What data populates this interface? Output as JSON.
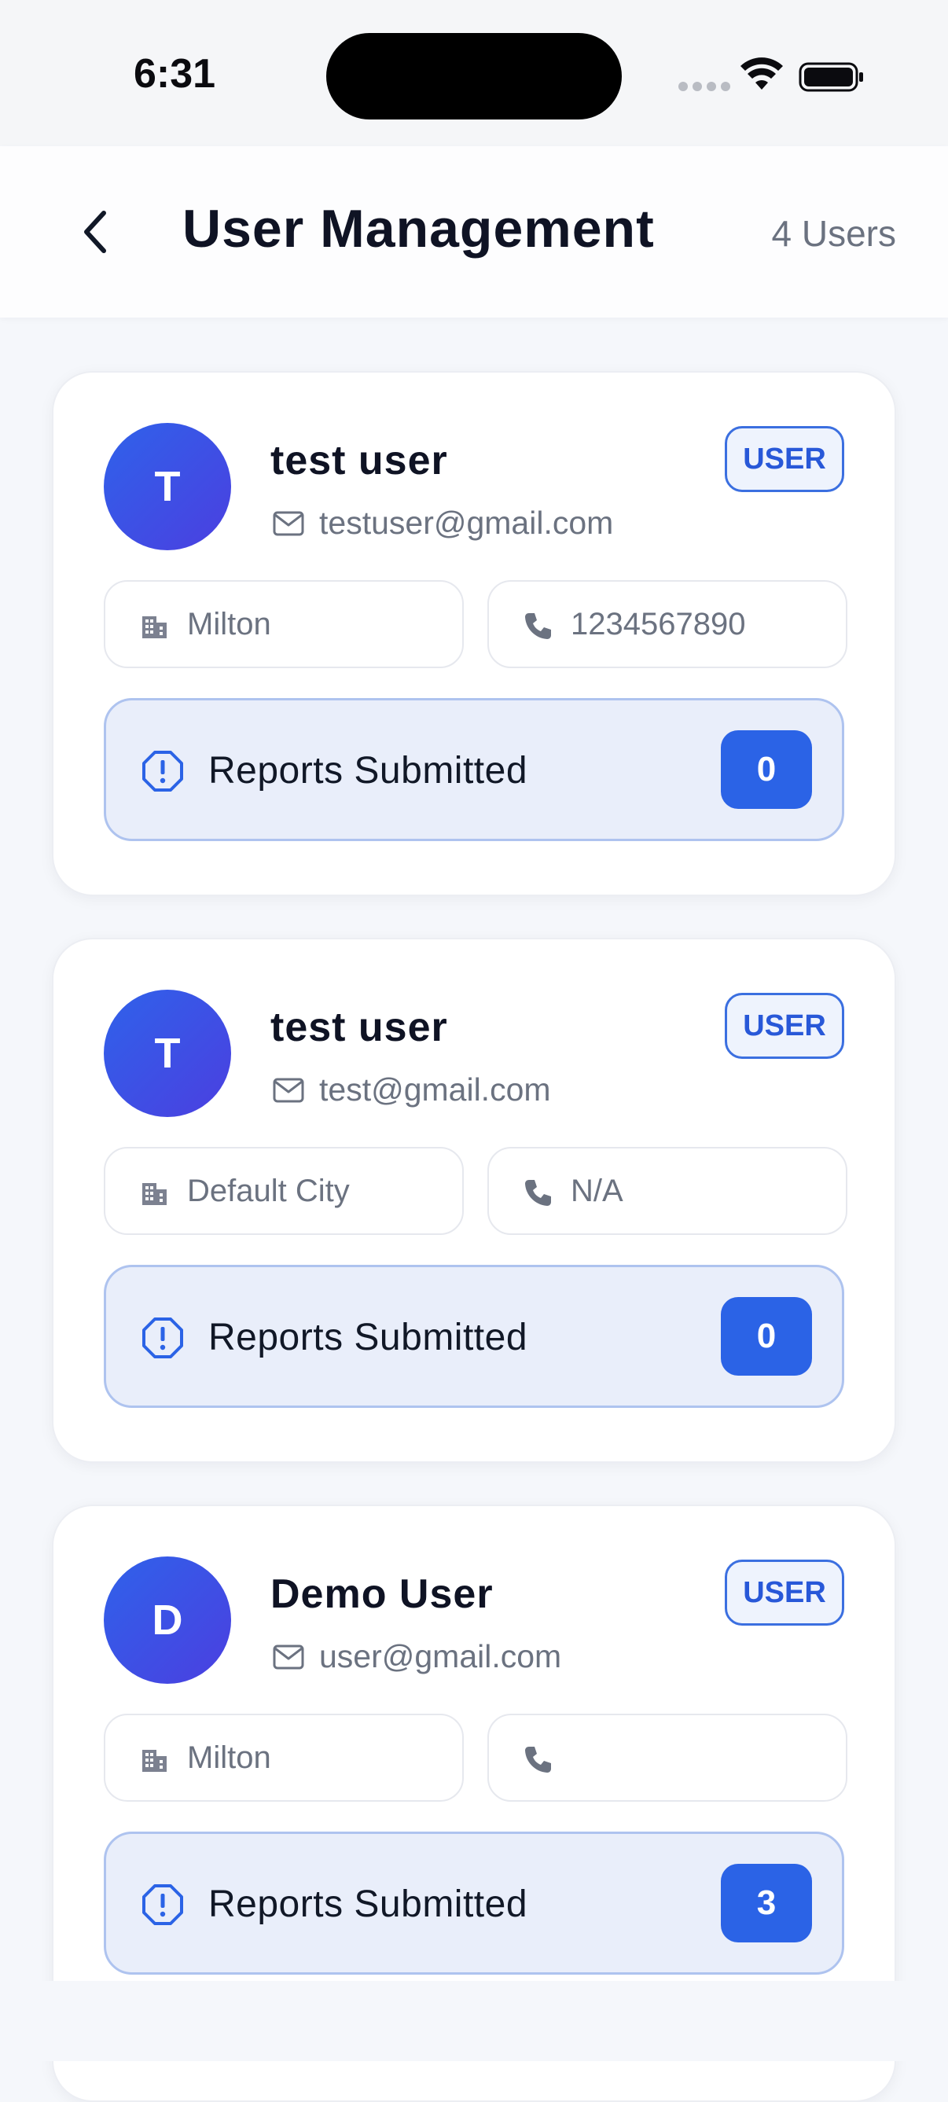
{
  "status_bar": {
    "time": "6:31"
  },
  "header": {
    "title": "User Management",
    "count_label": "4 Users"
  },
  "users": [
    {
      "initial": "T",
      "name": "test user",
      "email": "testuser@gmail.com",
      "role": "USER",
      "city": "Milton",
      "phone": "1234567890",
      "reports_label": "Reports Submitted",
      "reports_count": "0"
    },
    {
      "initial": "T",
      "name": "test user",
      "email": "test@gmail.com",
      "role": "USER",
      "city": "Default City",
      "phone": "N/A",
      "reports_label": "Reports Submitted",
      "reports_count": "0"
    },
    {
      "initial": "D",
      "name": "Demo User",
      "email": "user@gmail.com",
      "role": "USER",
      "city": "Milton",
      "phone": "",
      "reports_label": "Reports Submitted",
      "reports_count": "3"
    }
  ],
  "colors": {
    "accent": "#2b63e6",
    "badge_border": "#3b6fe0",
    "reports_background": "#e9eefa",
    "muted_text": "#6b7280"
  },
  "icons": {
    "back": "chevron-left-icon",
    "email": "mail-icon",
    "city": "building-icon",
    "phone": "phone-icon",
    "reports": "alert-octagon-icon"
  }
}
